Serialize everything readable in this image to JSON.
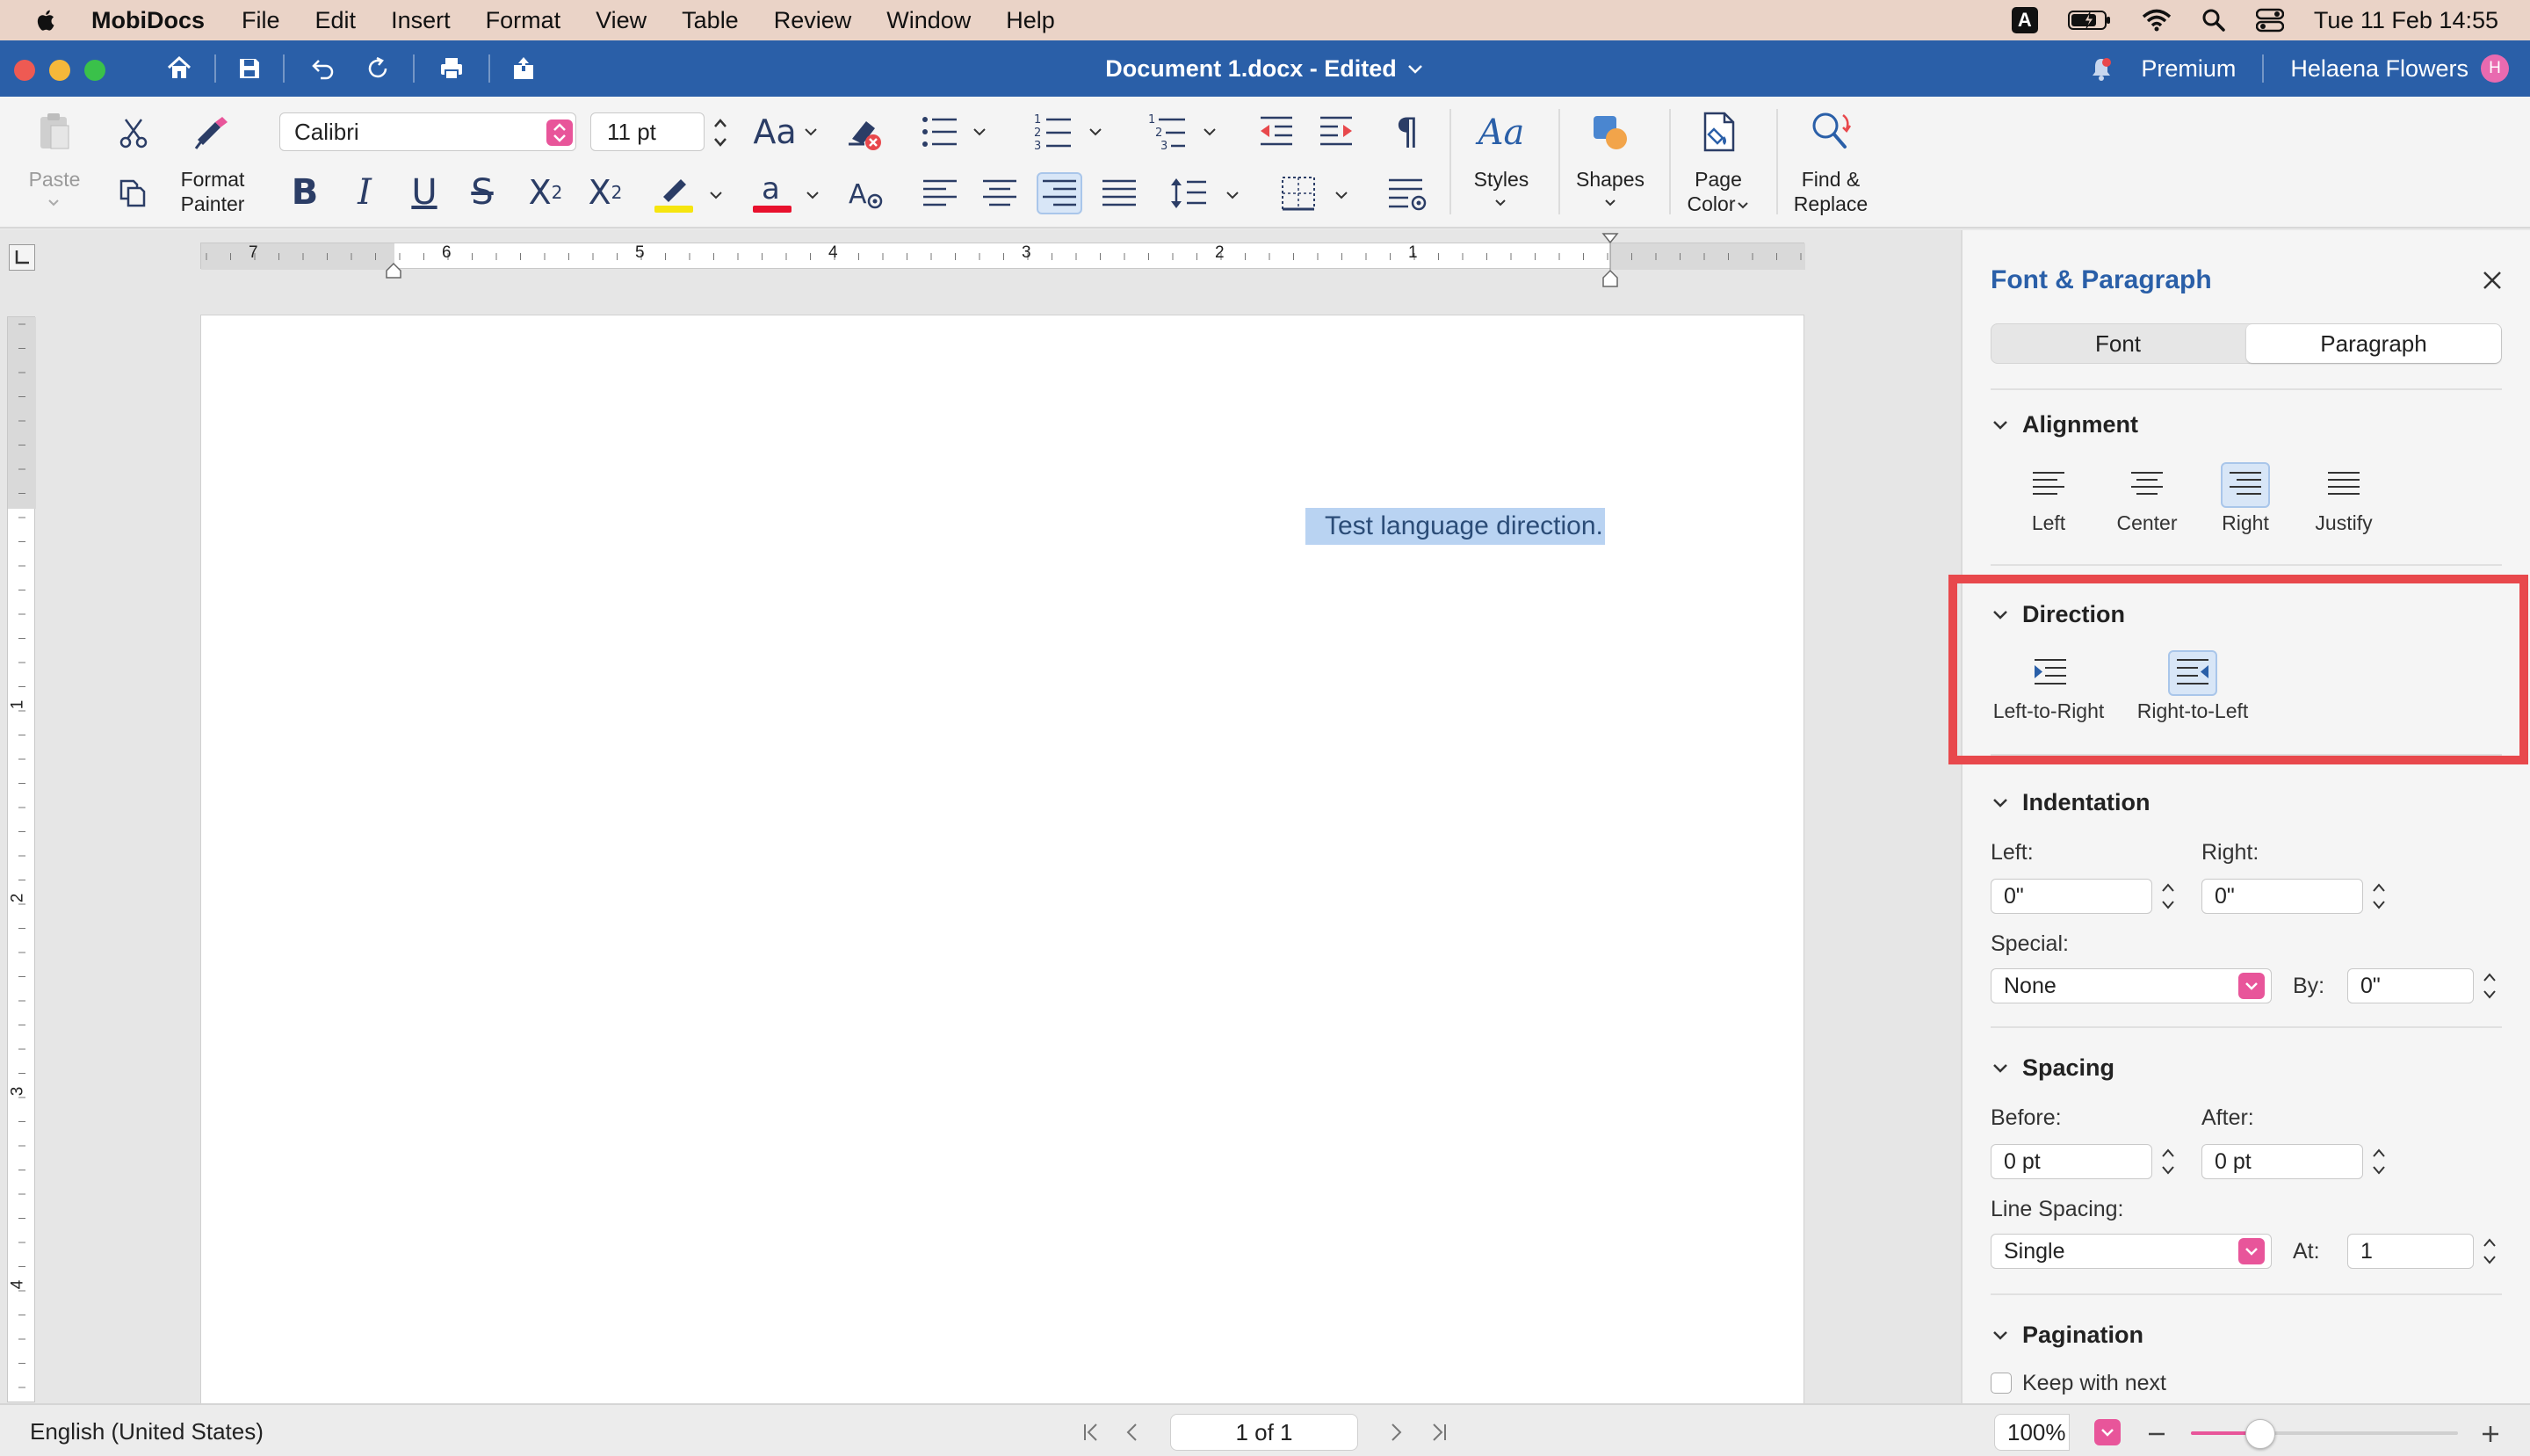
{
  "menubar": {
    "app_name": "MobiDocs",
    "items": [
      "File",
      "Edit",
      "Insert",
      "Format",
      "View",
      "Table",
      "Review",
      "Window",
      "Help"
    ],
    "keyboard_badge": "A",
    "datetime": "Tue 11 Feb  14:55"
  },
  "titlebar": {
    "document_title": "Document 1.docx - Edited",
    "premium": "Premium",
    "user_name": "Helaena Flowers",
    "avatar_initial": "H"
  },
  "ribbon": {
    "paste_label": "Paste",
    "format_painter_label": [
      "Format",
      "Painter"
    ],
    "font_name": "Calibri",
    "font_size": "11 pt",
    "case_label": "Aa",
    "styles_label": "Styles",
    "shapes_label": "Shapes",
    "page_color_label": [
      "Page",
      "Color"
    ],
    "find_replace_label": [
      "Find &",
      "Replace"
    ],
    "text_color": "#e8112d",
    "highlight_color": "#f6e50f"
  },
  "ruler": {
    "horizontal_numbers": [
      "7",
      "6",
      "5",
      "4",
      "3",
      "2",
      "1"
    ],
    "vertical_numbers": [
      "1",
      "2",
      "3",
      "4"
    ]
  },
  "document": {
    "selected_text": "Test language direction."
  },
  "panel": {
    "title": "Font & Paragraph",
    "tabs": [
      "Font",
      "Paragraph"
    ],
    "active_tab": "Paragraph",
    "alignment": {
      "heading": "Alignment",
      "options": [
        "Left",
        "Center",
        "Right",
        "Justify"
      ],
      "active": "Right"
    },
    "direction": {
      "heading": "Direction",
      "options": [
        "Left-to-Right",
        "Right-to-Left"
      ],
      "active": "Right-to-Left"
    },
    "indentation": {
      "heading": "Indentation",
      "left_label": "Left:",
      "left_value": "0\"",
      "right_label": "Right:",
      "right_value": "0\"",
      "special_label": "Special:",
      "special_value": "None",
      "by_label": "By:",
      "by_value": "0\""
    },
    "spacing": {
      "heading": "Spacing",
      "before_label": "Before:",
      "before_value": "0 pt",
      "after_label": "After:",
      "after_value": "0 pt",
      "line_spacing_label": "Line Spacing:",
      "line_spacing_value": "Single",
      "at_label": "At:",
      "at_value": "1"
    },
    "pagination": {
      "heading": "Pagination",
      "keep_with_next": "Keep with next"
    }
  },
  "statusbar": {
    "language": "English (United States)",
    "page_indicator": "1 of 1",
    "zoom": "100%",
    "zoom_level": 0.26
  },
  "colors": {
    "accent_blue": "#2a5fa8",
    "accent_pink": "#e8559a",
    "highlight_red": "#e8484c",
    "selection": "#b9d3f2"
  }
}
